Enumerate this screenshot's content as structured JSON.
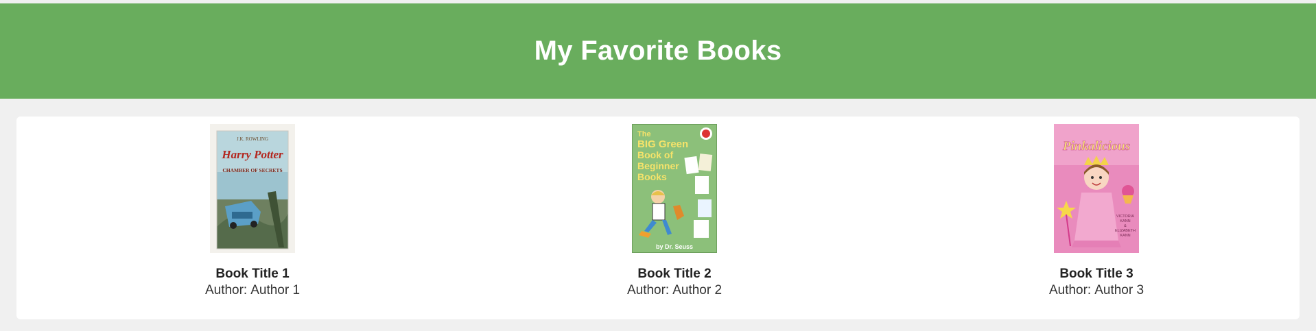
{
  "header": {
    "title": "My Favorite Books",
    "background": "#69ad5d"
  },
  "books": [
    {
      "title": "Book Title 1",
      "author_label": "Author:",
      "author": "Author 1",
      "cover": {
        "icon": "book-cover-image",
        "top_text": "J.K. ROWLING",
        "main_text": "Harry Potter",
        "sub_text": "CHAMBER OF SECRETS"
      }
    },
    {
      "title": "Book Title 2",
      "author_label": "Author:",
      "author": "Author 2",
      "cover": {
        "icon": "book-cover-image",
        "main_text": "The BIG Green Book of Beginner Books",
        "lines": [
          "The",
          "BIG Green",
          "Book of",
          "Beginner",
          "Books"
        ],
        "bottom_text": "by Dr. Seuss"
      }
    },
    {
      "title": "Book Title 3",
      "author_label": "Author:",
      "author": "Author 3",
      "cover": {
        "icon": "book-cover-image",
        "main_text": "Pinkalicious",
        "side_text": "VICTORIA KANN & ELIZABETH KANN",
        "side_lines": [
          "VICTORIA",
          "KANN",
          "&",
          "ELIZABETH",
          "KANN"
        ]
      }
    }
  ]
}
